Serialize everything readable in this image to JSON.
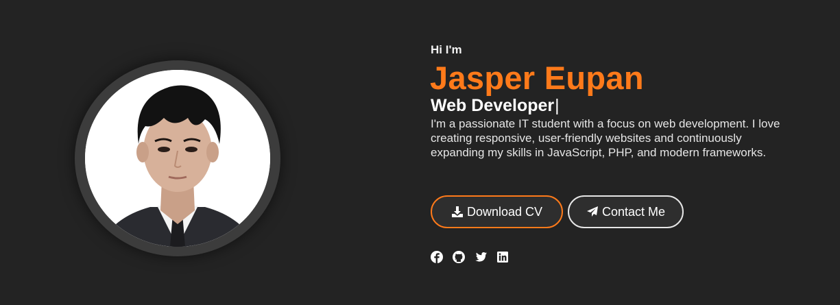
{
  "hero": {
    "greeting": "Hi I'm",
    "name": "Jasper Eupan",
    "role": "Web Developer",
    "cursor": "|",
    "bio": "I'm a passionate IT student with a focus on web development. I love creating responsive, user-friendly websites and continuously expanding my skills in JavaScript, PHP, and modern frameworks.",
    "download_label": "Download CV",
    "contact_label": "Contact Me"
  },
  "social": [
    {
      "icon": "facebook-icon"
    },
    {
      "icon": "github-icon"
    },
    {
      "icon": "twitter-icon"
    },
    {
      "icon": "linkedin-icon"
    }
  ],
  "colors": {
    "background": "#232323",
    "accent": "#ff7a1a",
    "text": "#ffffff"
  }
}
